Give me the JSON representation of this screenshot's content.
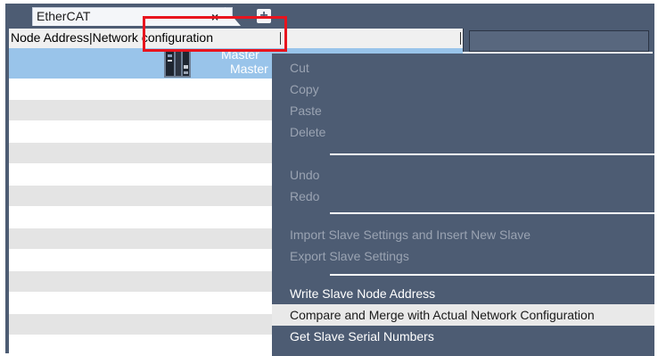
{
  "tab": {
    "title": "EtherCAT",
    "close_glyph": "×",
    "add_glyph": "+"
  },
  "grid": {
    "header": "Node Address|Network configuration",
    "master": {
      "name": "Master",
      "model": "Master",
      "icon": "controller-icon"
    }
  },
  "context_menu": {
    "items": [
      {
        "label": "Cut",
        "enabled": false
      },
      {
        "label": "Copy",
        "enabled": false
      },
      {
        "label": "Paste",
        "enabled": false
      },
      {
        "label": "Delete",
        "enabled": false
      },
      {
        "label": "Undo",
        "enabled": false
      },
      {
        "label": "Redo",
        "enabled": false
      },
      {
        "label": "Import Slave Settings and Insert New Slave",
        "enabled": false
      },
      {
        "label": "Export Slave Settings",
        "enabled": false
      },
      {
        "label": "Write Slave Node Address",
        "enabled": true
      },
      {
        "label": "Compare and Merge with Actual Network Configuration",
        "enabled": true,
        "selected": true
      },
      {
        "label": "Get Slave Serial Numbers",
        "enabled": true
      }
    ]
  },
  "colors": {
    "menu_bg": "#4d5c73",
    "selection_bg": "#99c4ea",
    "highlight_box": "#e8141e"
  }
}
